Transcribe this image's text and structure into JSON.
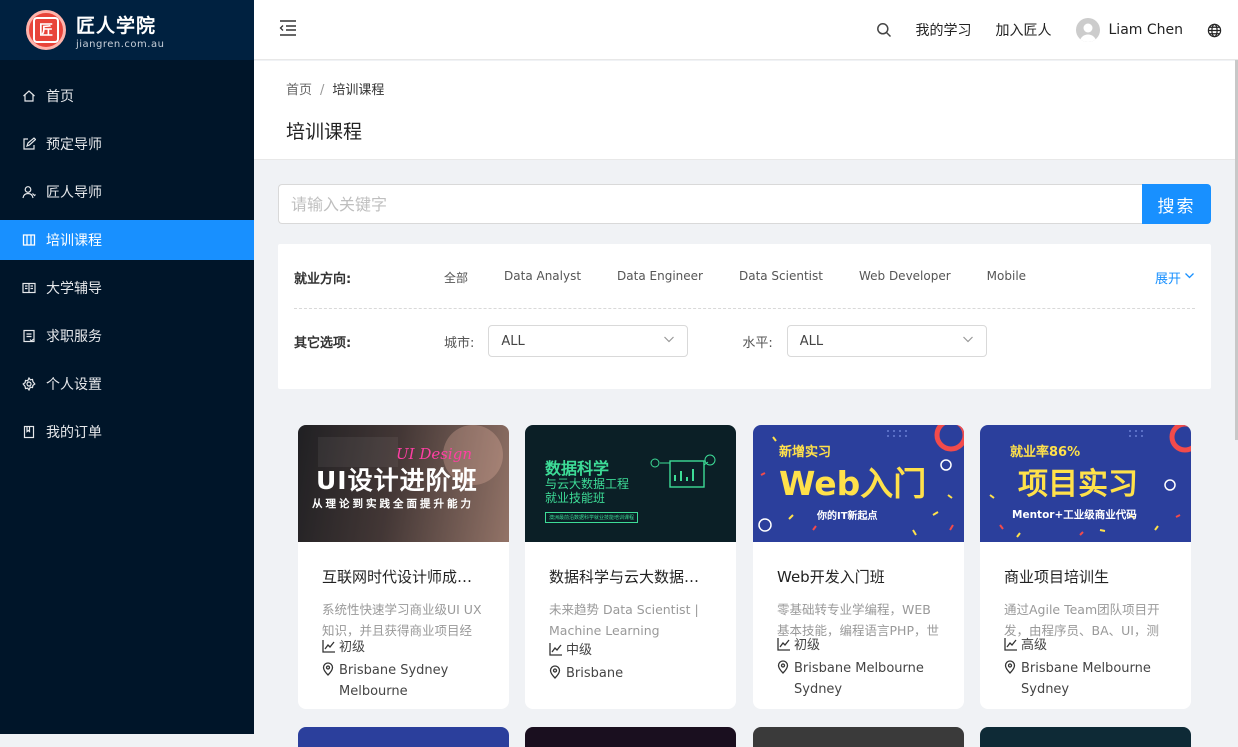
{
  "brand": {
    "title": "匠人学院",
    "subtitle": "jiangren.com.au"
  },
  "menu": [
    {
      "label": "首页",
      "icon": "home-icon",
      "active": false
    },
    {
      "label": "预定导师",
      "icon": "edit-icon",
      "active": false
    },
    {
      "label": "匠人导师",
      "icon": "user-icon",
      "active": false
    },
    {
      "label": "培训课程",
      "icon": "course-icon",
      "active": true
    },
    {
      "label": "大学辅导",
      "icon": "book-icon",
      "active": false
    },
    {
      "label": "求职服务",
      "icon": "document-icon",
      "active": false
    },
    {
      "label": "个人设置",
      "icon": "gear-icon",
      "active": false
    },
    {
      "label": "我的订单",
      "icon": "order-icon",
      "active": false
    }
  ],
  "header": {
    "my_learning": "我的学习",
    "join": "加入匠人",
    "user": "Liam Chen"
  },
  "breadcrumb": {
    "home": "首页",
    "separator": "/",
    "current": "培训课程"
  },
  "page_title": "培训课程",
  "search": {
    "placeholder": "请输入关键字",
    "button": "搜索"
  },
  "filters": {
    "direction_label": "就业方向:",
    "directions": [
      "全部",
      "Data Analyst",
      "Data Engineer",
      "Data Scientist",
      "Web Developer",
      "Mobile"
    ],
    "expand": "展开",
    "other_label": "其它选项:",
    "city_label": "城市:",
    "city_value": "ALL",
    "level_label": "水平:",
    "level_value": "ALL"
  },
  "courses": [
    {
      "title": "互联网时代设计师成长计划",
      "desc": "系统性快速学习商业级UI UX知识，并且获得商业项目经验，增加面试筹码",
      "level": "初级",
      "cities": "Brisbane Sydney Melbourne",
      "banner": {
        "line1": "UI设计进阶班",
        "line2": "从理论到实践全面提升能力",
        "script": "UI Design"
      }
    },
    {
      "title": "数据科学与云大数据工程",
      "desc": "未来趋势 Data Scientist | Machine Learning",
      "level": "中级",
      "cities": "Brisbane",
      "banner": {
        "line1": "数据科学",
        "line2": "与云大数据工程",
        "line3": "就业技能班",
        "note": "澳洲最前沿数据科学就业技能培训课程"
      }
    },
    {
      "title": "Web开发入门班",
      "desc": "零基础转专业学编程，WEB基本技能，编程语言PHP，世界最流行",
      "level": "初级",
      "cities": "Brisbane Melbourne Sydney",
      "banner": {
        "tag": "新增实习",
        "line1": "Web入门",
        "line2": "你的IT新起点"
      }
    },
    {
      "title": "商业项目培训生",
      "desc": "通过Agile Team团队项目开发，由程序员、BA、UI，测试组成，完成多个",
      "level": "高级",
      "cities": "Brisbane Melbourne Sydney",
      "banner": {
        "tag": "就业率86%",
        "line1": "项目实习",
        "line2": "Mentor+工业级商业代码"
      }
    }
  ],
  "colors": {
    "accent": "#1890ff",
    "sidebar": "#001529",
    "logo_bg": "#002140"
  }
}
